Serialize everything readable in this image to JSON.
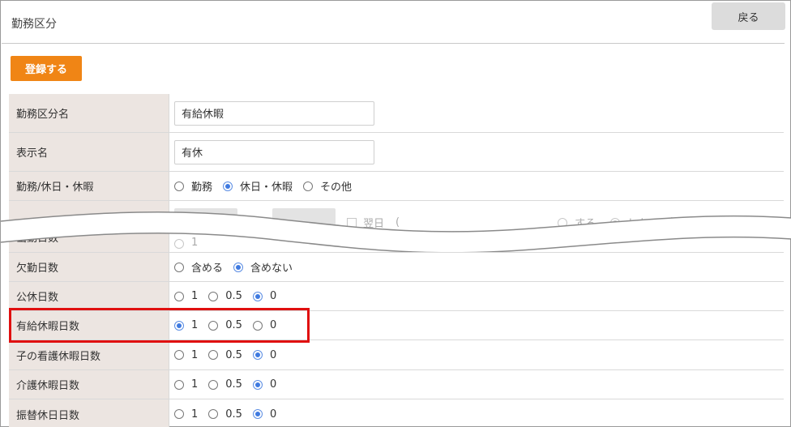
{
  "header": {
    "title": "勤務区分",
    "back_label": "戻る"
  },
  "actions": {
    "register_label": "登録する"
  },
  "form": {
    "name_label": "勤務区分名",
    "name_value": "有給休暇",
    "display_label": "表示名",
    "display_value": "有休",
    "type_label": "勤務/休日・休暇",
    "type_options": [
      "勤務",
      "休日・休暇",
      "その他"
    ],
    "type_selected": "休日・休暇",
    "time_separator": "〜",
    "next_day_label": "翌日",
    "partial_row": {
      "open_paren": "(",
      "opt_yes": "する",
      "opt_no": "しない",
      "close_paren": ")"
    },
    "work_days_label": "出勤日数",
    "work_days_option": "1",
    "absence_label": "欠勤日数",
    "absence_options": [
      "含める",
      "含めない"
    ],
    "absence_selected": "含めない",
    "public_holiday_label": "公休日数",
    "paid_leave_label": "有給休暇日数",
    "child_care_label": "子の看護休暇日数",
    "nursing_label": "介護休暇日数",
    "substitute_label": "振替休日日数",
    "day_options": [
      "1",
      "0.5",
      "0"
    ],
    "public_holiday_selected": "0",
    "paid_leave_selected": "1",
    "child_care_selected": "0",
    "nursing_selected": "0",
    "substitute_selected": "0"
  },
  "colors": {
    "accent": "#f08515",
    "highlight": "#e01010",
    "label_bg": "#ece5e1",
    "radio_checked": "#3f7ae0"
  }
}
